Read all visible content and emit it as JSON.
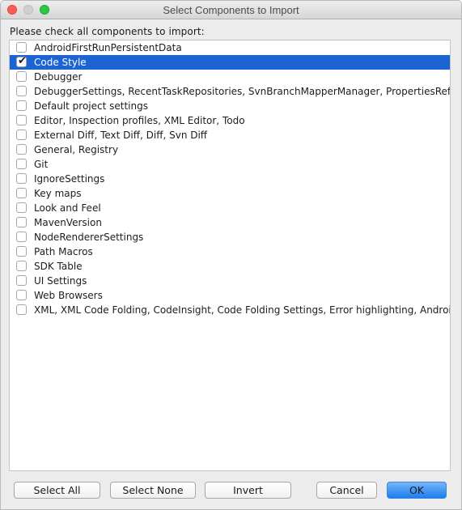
{
  "window": {
    "title": "Select Components to Import"
  },
  "prompt": "Please check all components to import:",
  "components": [
    {
      "label": "AndroidFirstRunPersistentData",
      "checked": false,
      "selected": false
    },
    {
      "label": "Code Style",
      "checked": true,
      "selected": true
    },
    {
      "label": "Debugger",
      "checked": false,
      "selected": false
    },
    {
      "label": "DebuggerSettings, RecentTaskRepositories, SvnBranchMapperManager, PropertiesRefa...",
      "checked": false,
      "selected": false
    },
    {
      "label": "Default project settings",
      "checked": false,
      "selected": false
    },
    {
      "label": "Editor, Inspection profiles, XML Editor, Todo",
      "checked": false,
      "selected": false
    },
    {
      "label": "External Diff, Text Diff, Diff, Svn Diff",
      "checked": false,
      "selected": false
    },
    {
      "label": "General, Registry",
      "checked": false,
      "selected": false
    },
    {
      "label": "Git",
      "checked": false,
      "selected": false
    },
    {
      "label": "IgnoreSettings",
      "checked": false,
      "selected": false
    },
    {
      "label": "Key maps",
      "checked": false,
      "selected": false
    },
    {
      "label": "Look and Feel",
      "checked": false,
      "selected": false
    },
    {
      "label": "MavenVersion",
      "checked": false,
      "selected": false
    },
    {
      "label": "NodeRendererSettings",
      "checked": false,
      "selected": false
    },
    {
      "label": "Path Macros",
      "checked": false,
      "selected": false
    },
    {
      "label": "SDK Table",
      "checked": false,
      "selected": false
    },
    {
      "label": "UI Settings",
      "checked": false,
      "selected": false
    },
    {
      "label": "Web Browsers",
      "checked": false,
      "selected": false
    },
    {
      "label": "XML, XML Code Folding, CodeInsight, Code Folding Settings, Error highlighting, Android...",
      "checked": false,
      "selected": false
    }
  ],
  "buttons": {
    "select_all": "Select All",
    "select_none": "Select None",
    "invert": "Invert",
    "cancel": "Cancel",
    "ok": "OK"
  },
  "colors": {
    "selection": "#1c63d4",
    "default_button": "#1c7dee",
    "close": "#fc5f57",
    "minimize": "#d0d0d0",
    "maximize": "#2ac940"
  }
}
